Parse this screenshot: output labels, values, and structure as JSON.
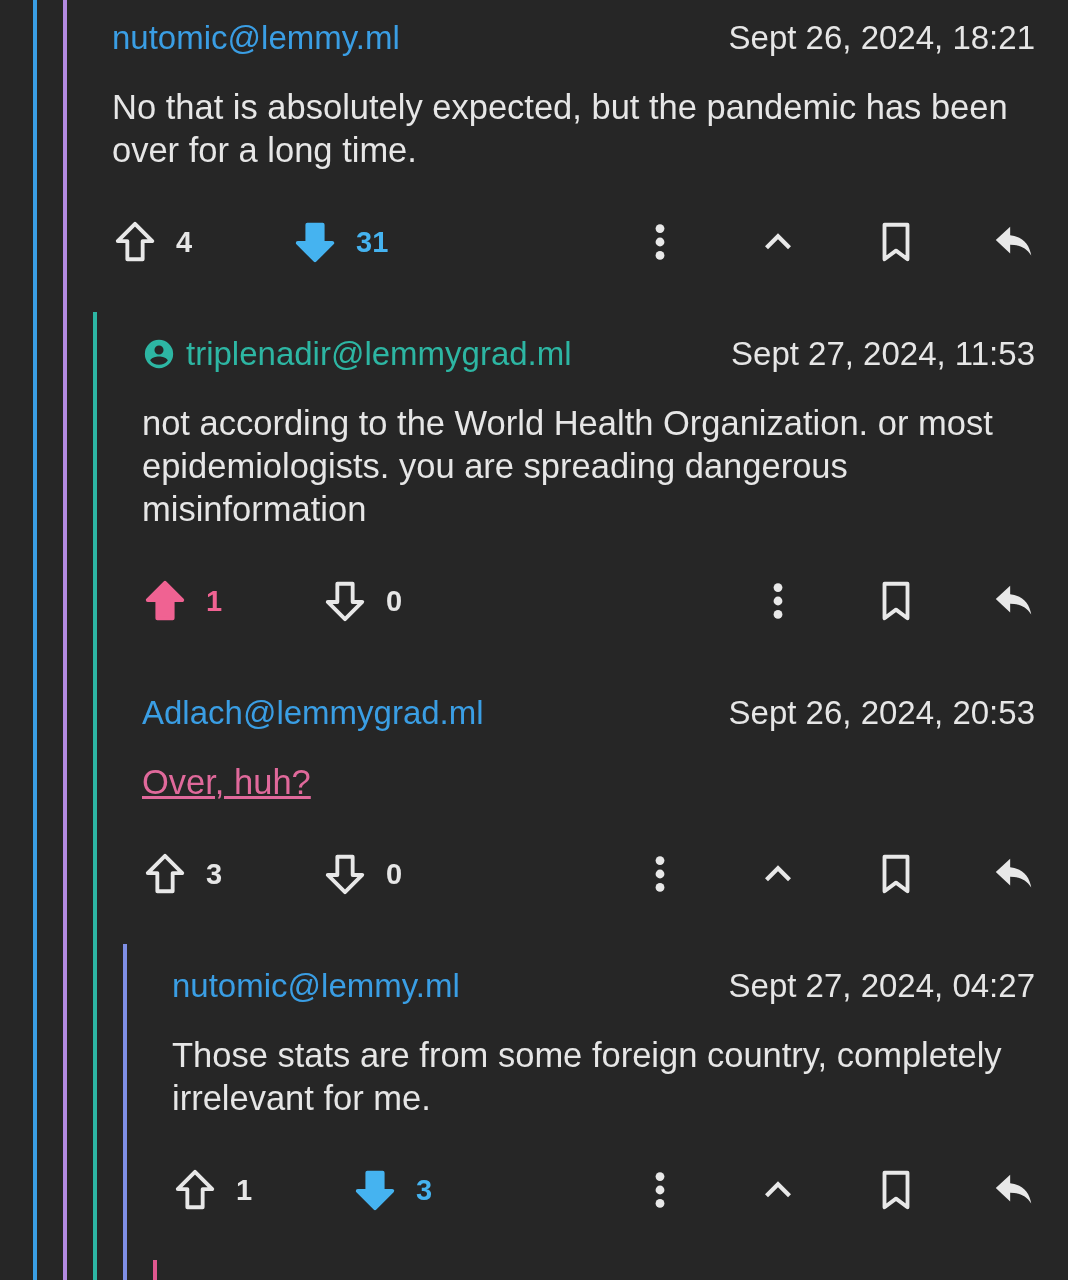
{
  "comments": [
    {
      "author": "nutomic@lemmy.ml",
      "is_op": false,
      "date": "Sept 26, 2024, 18:21",
      "body": {
        "kind": "text",
        "text": "No that is absolutely expected, but the pandemic has been over for a long time."
      },
      "upvotes": "4",
      "downvotes": "31",
      "upvoted": false,
      "downvoted": true,
      "collapsible": true,
      "children": [
        {
          "author": "triplenadir@lemmygrad.ml",
          "is_op": true,
          "date": "Sept 27, 2024, 11:53",
          "body": {
            "kind": "text",
            "text": "not according to the World Health Organization. or most epidemiologists. you are spreading dangerous misinformation"
          },
          "upvotes": "1",
          "downvotes": "0",
          "upvoted": true,
          "downvoted": false,
          "collapsible": false
        },
        {
          "author": "Adlach@lemmygrad.ml",
          "is_op": false,
          "date": "Sept 26, 2024, 20:53",
          "body": {
            "kind": "link",
            "text": "Over, huh?"
          },
          "upvotes": "3",
          "downvotes": "0",
          "upvoted": false,
          "downvoted": false,
          "collapsible": true,
          "children": [
            {
              "author": "nutomic@lemmy.ml",
              "is_op": false,
              "date": "Sept 27, 2024, 04:27",
              "body": {
                "kind": "text",
                "text": "Those stats are from some foreign country, completely irrelevant for me."
              },
              "upvotes": "1",
              "downvotes": "3",
              "upvoted": false,
              "downvoted": true,
              "collapsible": true,
              "continues": true
            }
          ]
        }
      ]
    }
  ]
}
